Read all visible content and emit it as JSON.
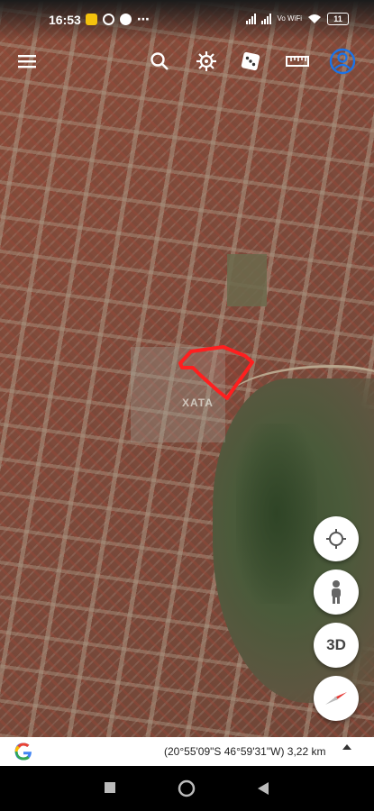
{
  "status_bar": {
    "time": "16:53",
    "network_label": "Vo WiFi",
    "battery": "11"
  },
  "toolbar": {
    "icons": [
      "menu-icon",
      "search-icon",
      "voyager-helm-icon",
      "feeling-lucky-dice-icon",
      "measure-ruler-icon",
      "account-icon"
    ]
  },
  "map": {
    "watermark": "XATA"
  },
  "fabs": {
    "three_d_label": "3D"
  },
  "bottom_bar": {
    "coordinates": "(20°55'09\"S 46°59'31\"W) 3,22 km"
  },
  "colors": {
    "highlight_outline": "#ff1f1f",
    "account_blue": "#1a73e8"
  }
}
